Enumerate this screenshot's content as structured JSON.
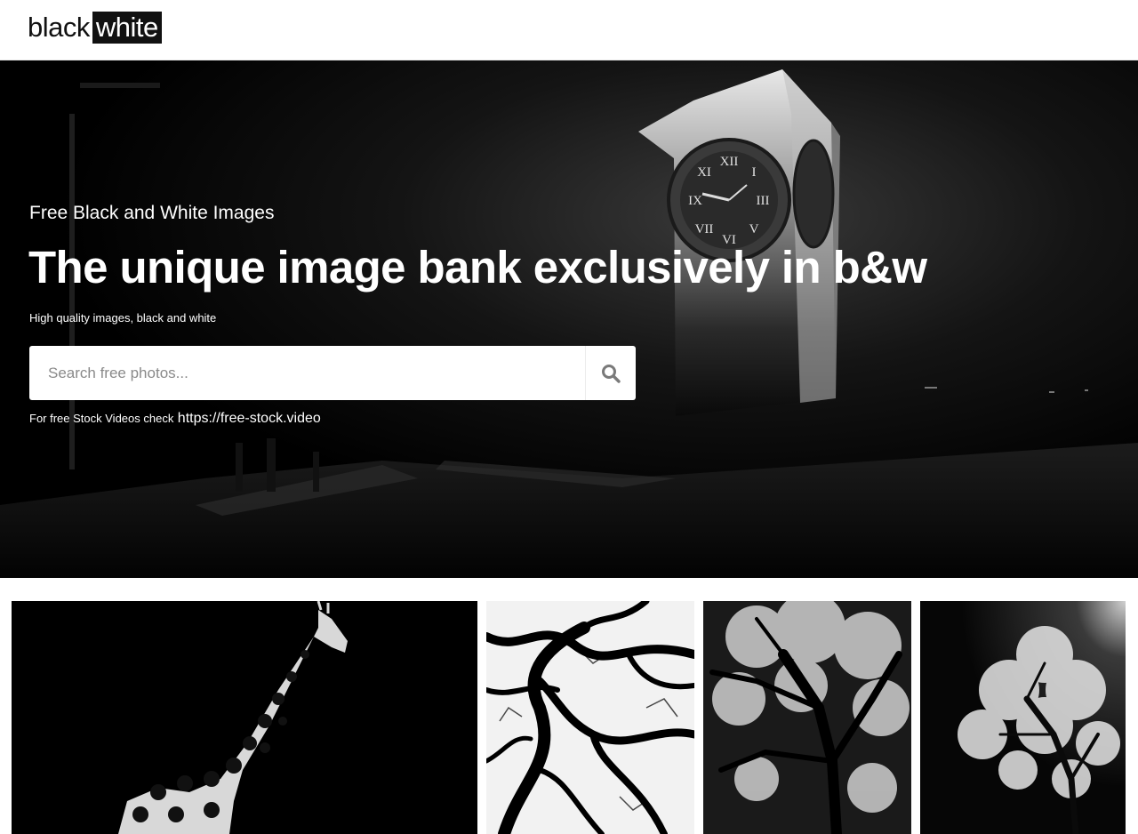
{
  "header": {
    "logo_black": "black",
    "logo_white": "white"
  },
  "hero": {
    "eyebrow": "Free Black and White Images",
    "title": "The unique image bank exclusively in b&w",
    "subtitle": "High quality images, black and white",
    "search": {
      "placeholder": "Search free photos...",
      "button_icon": "search-icon"
    },
    "video_note": {
      "label": "For free Stock Videos check",
      "link_text": "https://free-stock.video"
    }
  },
  "gallery": {
    "photos": [
      {
        "subject": "giraffe",
        "icon": "giraffe-photo"
      },
      {
        "subject": "tree branches",
        "icon": "branches-photo"
      },
      {
        "subject": "tree",
        "icon": "tree-photo"
      },
      {
        "subject": "blossoming tree",
        "icon": "blossom-tree-photo"
      }
    ]
  },
  "colors": {
    "background": "#ffffff",
    "hero_bg": "#000000",
    "text_light": "#ffffff",
    "placeholder": "#8a8a8a",
    "logo_dark": "#111111"
  }
}
